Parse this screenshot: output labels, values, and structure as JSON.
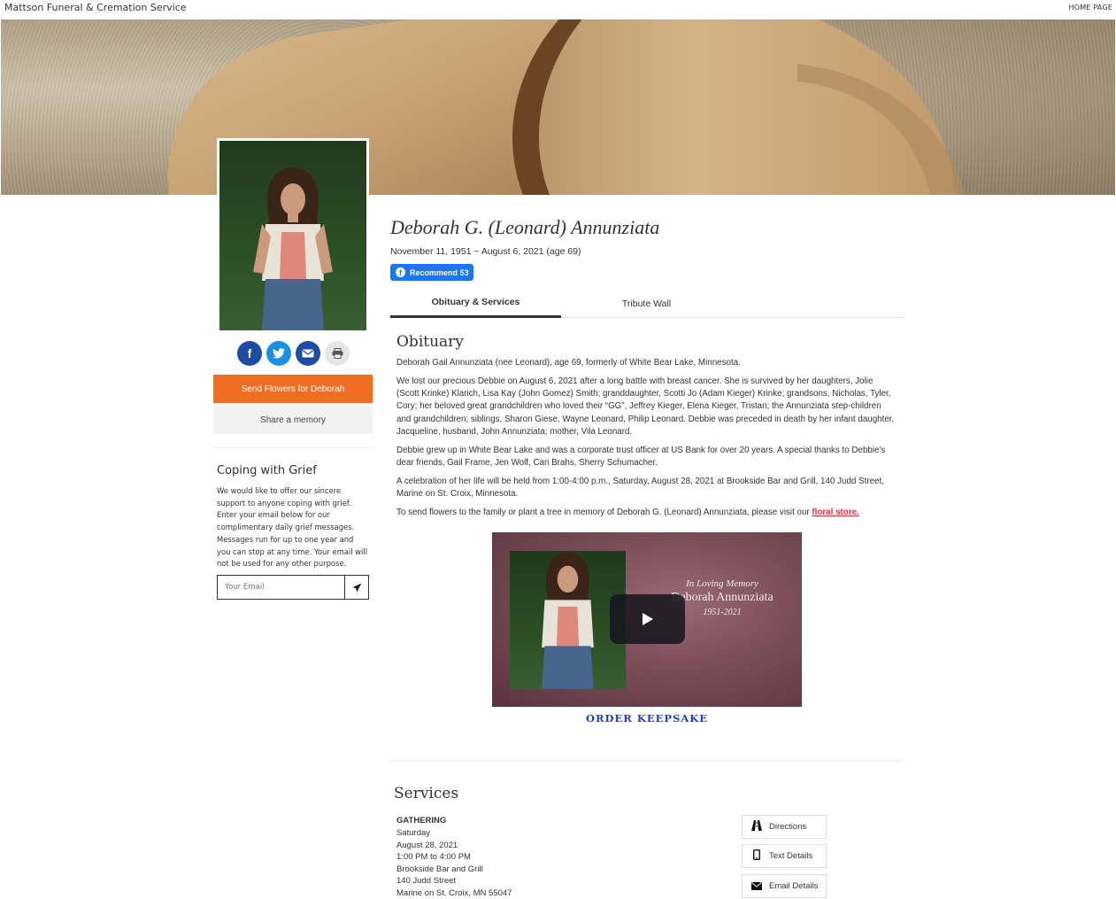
{
  "site": {
    "name": "Mattson Funeral & Cremation Service",
    "home_link": "HOME PAGE"
  },
  "person": {
    "name": "Deborah G. (Leonard) Annunziata",
    "dates": "November 11, 1951 ~ August 6, 2021 (age 69)",
    "recommend_label": "Recommend 53"
  },
  "sidebar": {
    "share_icons": [
      "facebook-icon",
      "twitter-icon",
      "email-icon",
      "print-icon"
    ],
    "flowers_button": "Send Flowers for Deborah",
    "memory_button": "Share a memory",
    "grief": {
      "title": "Coping with Grief",
      "text": "We would like to offer our sincere support to anyone coping with grief. Enter your email below for our complimentary daily grief messages. Messages run for up to one year and you can stop at any time. Your email will not be used for any other purpose.",
      "email_placeholder": "Your Email"
    }
  },
  "tabs": [
    {
      "label": "Obituary & Services",
      "active": true
    },
    {
      "label": "Tribute Wall",
      "active": false
    }
  ],
  "obituary": {
    "title": "Obituary",
    "paragraphs": [
      "Deborah Gail Annunziata (nee Leonard), age 69, formerly of White Bear Lake, Minnesota.",
      "We lost our precious Debbie on August 6, 2021 after a long battle with breast cancer.  She is survived by her daughters, Jolie (Scott Krinke) Klarich, Lisa Kay (John Gomez) Smith;  granddaughter, Scotti Jo (Adam Kieger) Krinke; grandsons, Nicholas, Tyler, Cory; her beloved great grandchildren who loved their “GG”, Jeffrey Kieger, Elena Kieger, Tristan; the Annunziata step-children and grandchildren; siblings, Sharon Giese, Wayne Leonard, Philip Leonard.  Debbie was preceded in death by her infant daughter, Jacqueline, husband, John Annunziata; mother, Vila Leonard.",
      "Debbie grew up in White Bear Lake and was a corporate trust officer at US Bank for over 20 years.  A special thanks to Debbie's dear friends, Gail Frame, Jen Wolf, Cari Brahs, Sherry Schumacher.",
      "A celebration of her life will be held from 1:00-4:00 p.m., Saturday, August 28, 2021 at Brookside Bar and Grill, 140 Judd Street, Marine on St. Croix, Minnesota."
    ],
    "flowers_sentence": "To send flowers to the family or plant a tree in memory of Deborah G. (Leonard) Annunziata, please visit our ",
    "floral_link": "floral store."
  },
  "video": {
    "line1": "In Loving Memory",
    "line2": "Deborah Annunziata",
    "line3": "1951-2021",
    "keepsake_label": "ORDER KEEPSAKE"
  },
  "services": {
    "title": "Services",
    "type": "GATHERING",
    "lines": [
      "Saturday",
      "August 28, 2021",
      "1:00 PM to 4:00 PM",
      "Brookside Bar and Grill",
      "140 Judd Street",
      "Marine on St. Croix, MN 55047"
    ],
    "buttons": [
      "Directions",
      "Text Details",
      "Email Details"
    ]
  },
  "colors": {
    "accent": "#f16d22",
    "facebook": "#1877f2",
    "link": "#2340b8",
    "floral": "#e0343a"
  }
}
